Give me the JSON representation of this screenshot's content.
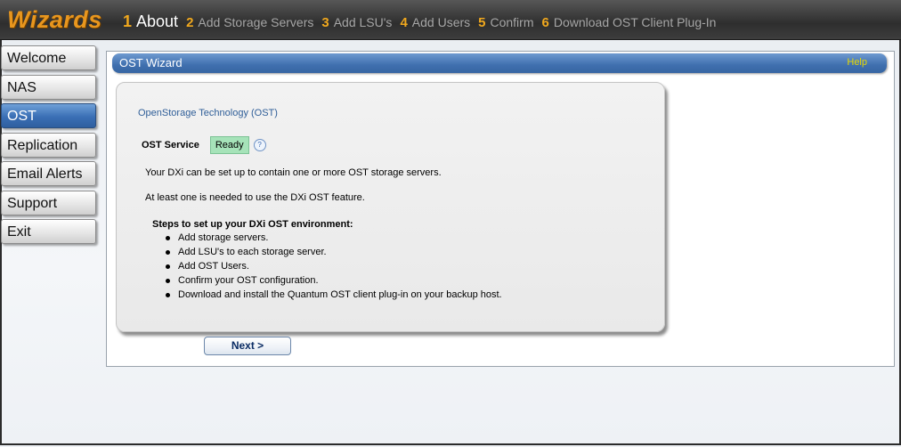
{
  "header": {
    "app_title": "Wizards",
    "steps": [
      {
        "num": "1",
        "label": "About"
      },
      {
        "num": "2",
        "label": "Add Storage Servers"
      },
      {
        "num": "3",
        "label": "Add LSU's"
      },
      {
        "num": "4",
        "label": "Add Users"
      },
      {
        "num": "5",
        "label": "Confirm"
      },
      {
        "num": "6",
        "label": "Download OST Client Plug-In"
      }
    ],
    "active_step": "1"
  },
  "nav": {
    "items": [
      {
        "label": "Welcome"
      },
      {
        "label": "NAS"
      },
      {
        "label": "OST"
      },
      {
        "label": "Replication"
      },
      {
        "label": "Email Alerts"
      },
      {
        "label": "Support"
      },
      {
        "label": "Exit"
      }
    ],
    "active": "OST"
  },
  "panel": {
    "title": "OST Wizard",
    "help_label": "Help"
  },
  "card": {
    "heading": "OpenStorage Technology (OST)",
    "service_label": "OST Service",
    "service_status": "Ready",
    "help_icon": "?",
    "paragraph1": "Your DXi can be set up to contain one or more OST storage servers.",
    "paragraph2": "At least one is needed to use the DXi OST feature.",
    "steps_heading": "Steps to set up your DXi OST environment:",
    "steps": [
      "Add storage servers.",
      "Add LSU's to each storage server.",
      "Add OST Users.",
      "Confirm your OST configuration.",
      "Download and install the Quantum OST client plug-in on your backup host."
    ]
  },
  "actions": {
    "next_label": "Next >"
  },
  "colors": {
    "accent_orange": "#e8961e",
    "nav_active": "#3a6fb5",
    "status_ready": "#a6e3b9",
    "help_yellow": "#e7d800"
  }
}
